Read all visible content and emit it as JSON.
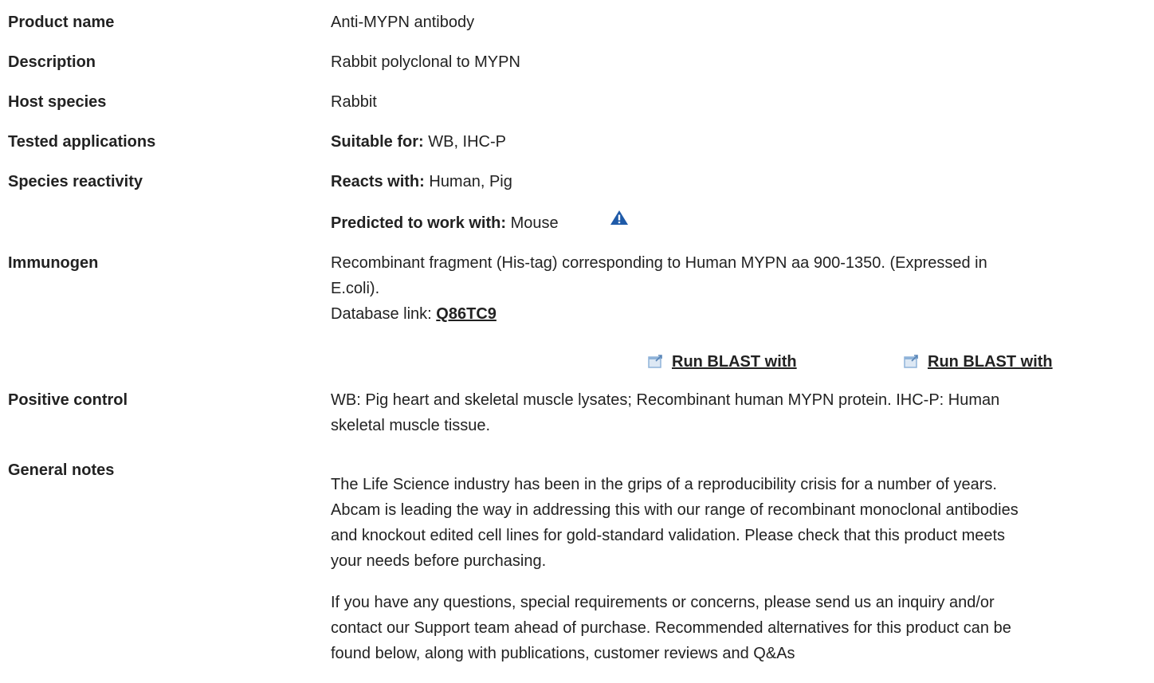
{
  "rows": {
    "product_name": {
      "label": "Product name",
      "value": "Anti-MYPN antibody"
    },
    "description": {
      "label": "Description",
      "value": "Rabbit polyclonal to MYPN"
    },
    "host_species": {
      "label": "Host species",
      "value": "Rabbit"
    },
    "tested_applications": {
      "label": "Tested applications",
      "prefix": "Suitable for:",
      "value": " WB, IHC-P"
    },
    "species_reactivity": {
      "label": "Species reactivity",
      "reacts_prefix": "Reacts with:",
      "reacts_value": " Human, Pig",
      "predicted_prefix": "Predicted to work with:",
      "predicted_value": " Mouse",
      "warning_icon": "warning-triangle-icon"
    },
    "immunogen": {
      "label": "Immunogen",
      "line1": "Recombinant fragment (His-tag) corresponding to Human MYPN aa 900-1350. (Expressed in",
      "line2": "E.coli).",
      "db_prefix": "Database link: ",
      "db_link": "Q86TC9",
      "blast_1": "Run BLAST with",
      "blast_2": "Run BLAST with",
      "blast_icon": "external-window-icon"
    },
    "positive_control": {
      "label": "Positive control",
      "line1": "WB: Pig heart and skeletal muscle lysates; Recombinant human MYPN protein. IHC-P: Human",
      "line2": "skeletal muscle tissue."
    },
    "general_notes": {
      "label": "General notes",
      "p1_l1": "The Life Science industry has been in the grips of a reproducibility crisis for a number of years.",
      "p1_l2": "Abcam is leading the way in addressing this with our range of recombinant monoclonal antibodies",
      "p1_l3": "and knockout edited cell lines for gold-standard validation. Please check that this product meets",
      "p1_l4": "your needs before purchasing.",
      "p2_l1": "If you have any questions, special requirements or concerns, please send us an inquiry and/or",
      "p2_l2": "contact our Support team ahead of purchase. Recommended alternatives for this product can be",
      "p2_l3": "found below, along with publications, customer reviews and Q&As"
    }
  },
  "colors": {
    "text": "#222222",
    "warning_icon": "#1e5aa8",
    "blast_icon": "#8fb3d9"
  }
}
